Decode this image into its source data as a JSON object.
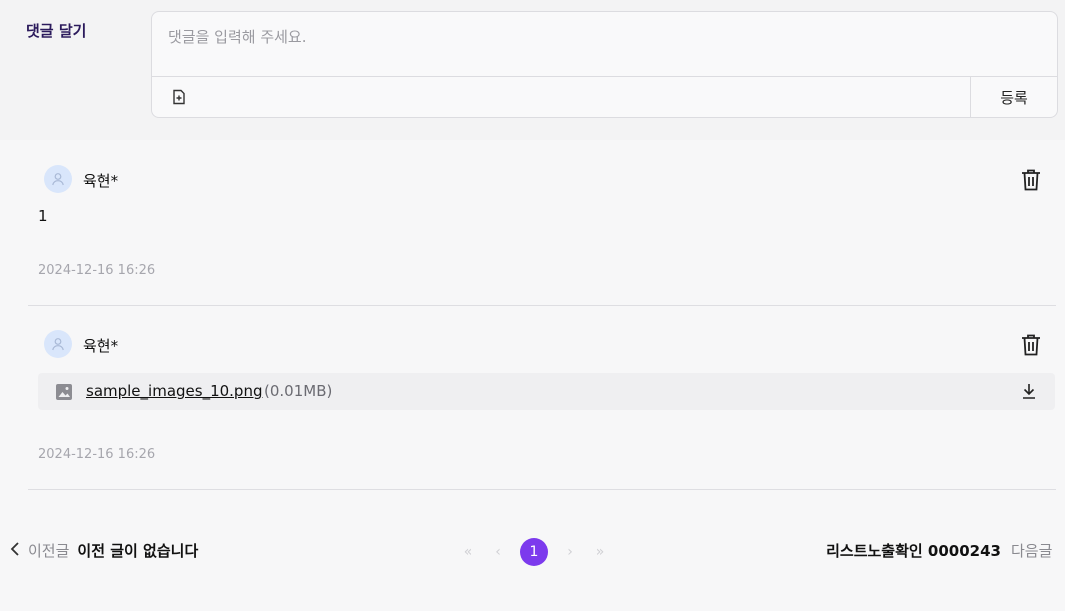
{
  "comment_form": {
    "label": "댓글 달기",
    "placeholder": "댓글을 입력해 주세요.",
    "submit_label": "등록"
  },
  "comments": [
    {
      "author": "육현*",
      "body": "1",
      "date": "2024-12-16 16:26"
    },
    {
      "author": "육현*",
      "attachment": {
        "name": "sample_images_10.png",
        "size": "(0.01MB)"
      },
      "date": "2024-12-16 16:26"
    }
  ],
  "navigation": {
    "prev_label": "이전글",
    "prev_title": "이전 글이 없습니다",
    "current_page": "1",
    "next_title": "리스트노출확인 0000243",
    "next_label": "다음글"
  },
  "colors": {
    "accent": "#7c3aed",
    "avatar_bg": "#d9e6fb"
  }
}
